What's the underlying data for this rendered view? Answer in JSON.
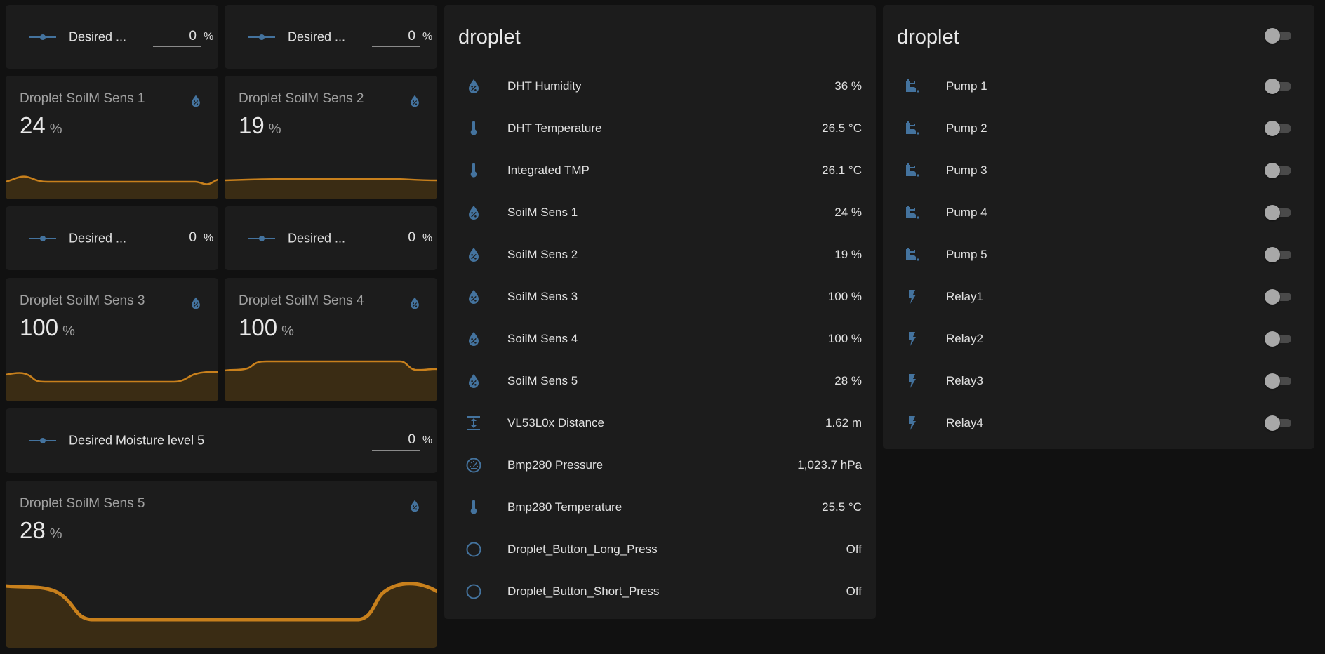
{
  "colors": {
    "background": "#111111",
    "card": "#1c1c1c",
    "icon": "#44739e",
    "graph_line": "#c8801c",
    "graph_fill": "#3a2c14",
    "toggle_track": "#4a4a4a",
    "toggle_knob": "#a8a8a8"
  },
  "number_inputs": [
    {
      "label": "Desired ...",
      "value": "0",
      "unit": "%",
      "icon": "slider-icon"
    },
    {
      "label": "Desired ...",
      "value": "0",
      "unit": "%",
      "icon": "slider-icon"
    },
    {
      "label": "Desired ...",
      "value": "0",
      "unit": "%",
      "icon": "slider-icon"
    },
    {
      "label": "Desired ...",
      "value": "0",
      "unit": "%",
      "icon": "slider-icon"
    },
    {
      "label": "Desired Moisture level 5",
      "value": "0",
      "unit": "%",
      "icon": "slider-icon"
    }
  ],
  "sensor_cards": [
    {
      "name": "Droplet SoilM Sens 1",
      "value": "24",
      "unit": "%",
      "icon": "water-percent-icon"
    },
    {
      "name": "Droplet SoilM Sens 2",
      "value": "19",
      "unit": "%",
      "icon": "water-percent-icon"
    },
    {
      "name": "Droplet SoilM Sens 3",
      "value": "100",
      "unit": "%",
      "icon": "water-percent-icon"
    },
    {
      "name": "Droplet SoilM Sens 4",
      "value": "100",
      "unit": "%",
      "icon": "water-percent-icon"
    },
    {
      "name": "Droplet SoilM Sens 5",
      "value": "28",
      "unit": "%",
      "icon": "water-percent-icon"
    }
  ],
  "sensors_card": {
    "title": "droplet",
    "rows": [
      {
        "label": "DHT Humidity",
        "value": "36 %",
        "icon": "water-percent-icon"
      },
      {
        "label": "DHT Temperature",
        "value": "26.5 °C",
        "icon": "thermometer-icon"
      },
      {
        "label": "Integrated TMP",
        "value": "26.1 °C",
        "icon": "thermometer-icon"
      },
      {
        "label": "SoilM Sens 1",
        "value": "24 %",
        "icon": "water-percent-icon"
      },
      {
        "label": "SoilM Sens 2",
        "value": "19 %",
        "icon": "water-percent-icon"
      },
      {
        "label": "SoilM Sens 3",
        "value": "100 %",
        "icon": "water-percent-icon"
      },
      {
        "label": "SoilM Sens 4",
        "value": "100 %",
        "icon": "water-percent-icon"
      },
      {
        "label": "SoilM Sens 5",
        "value": "28 %",
        "icon": "water-percent-icon"
      },
      {
        "label": "VL53L0x Distance",
        "value": "1.62 m",
        "icon": "distance-icon"
      },
      {
        "label": "Bmp280 Pressure",
        "value": "1,023.7 hPa",
        "icon": "gauge-icon"
      },
      {
        "label": "Bmp280 Temperature",
        "value": "25.5 °C",
        "icon": "thermometer-icon"
      },
      {
        "label": "Droplet_Button_Long_Press",
        "value": "Off",
        "icon": "circle-outline-icon"
      },
      {
        "label": "Droplet_Button_Short_Press",
        "value": "Off",
        "icon": "circle-outline-icon"
      }
    ]
  },
  "switches_card": {
    "title": "droplet",
    "header_toggle": "off",
    "rows": [
      {
        "label": "Pump 1",
        "state": "off",
        "icon": "water-pump-icon"
      },
      {
        "label": "Pump 2",
        "state": "off",
        "icon": "water-pump-icon"
      },
      {
        "label": "Pump 3",
        "state": "off",
        "icon": "water-pump-icon"
      },
      {
        "label": "Pump 4",
        "state": "off",
        "icon": "water-pump-icon"
      },
      {
        "label": "Pump 5",
        "state": "off",
        "icon": "water-pump-icon"
      },
      {
        "label": "Relay1",
        "state": "off",
        "icon": "flash-icon"
      },
      {
        "label": "Relay2",
        "state": "off",
        "icon": "flash-icon"
      },
      {
        "label": "Relay3",
        "state": "off",
        "icon": "flash-icon"
      },
      {
        "label": "Relay4",
        "state": "off",
        "icon": "flash-icon"
      }
    ]
  }
}
